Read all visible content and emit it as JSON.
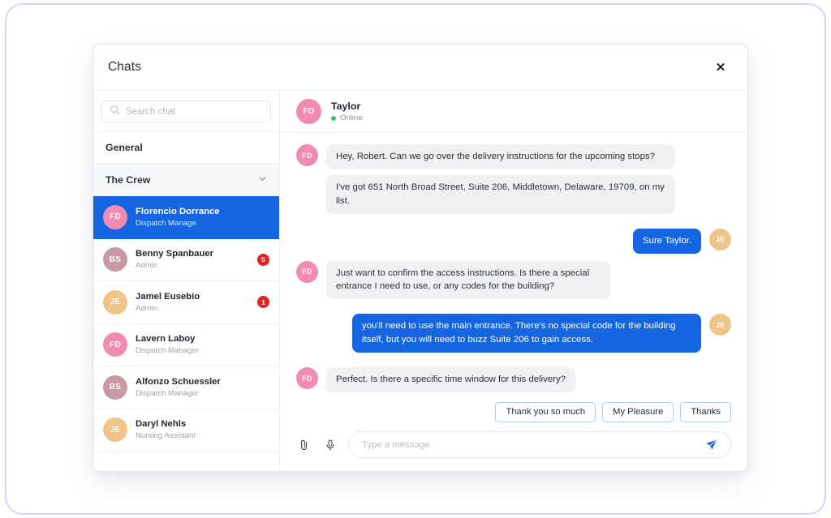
{
  "modal": {
    "title": "Chats",
    "close_icon": "close-icon"
  },
  "sidebar": {
    "search": {
      "placeholder": "Search chat",
      "value": "",
      "icon": "search-icon"
    },
    "groups": [
      {
        "label": "General",
        "expandable": false
      },
      {
        "label": "The Crew",
        "expandable": true,
        "chevron_icon": "chevron-down-icon"
      }
    ],
    "contacts": [
      {
        "initials": "FD",
        "name": "Florencio Dorrance",
        "role": "Dispatch Manage",
        "badge": "",
        "selected": true,
        "avatar_color": "#f08cb4"
      },
      {
        "initials": "BS",
        "name": "Benny Spanbauer",
        "role": "Admin",
        "badge": "5",
        "selected": false,
        "avatar_color": "#c59aa4"
      },
      {
        "initials": "JE",
        "name": "Jamel Eusebio",
        "role": "Admin",
        "badge": "1",
        "selected": false,
        "avatar_color": "#eec488"
      },
      {
        "initials": "FD",
        "name": "Lavern Laboy",
        "role": "Dispatch Manager",
        "badge": "",
        "selected": false,
        "avatar_color": "#f08cb4"
      },
      {
        "initials": "BS",
        "name": "Alfonzo Schuessler",
        "role": "Dispatch Manager",
        "badge": "",
        "selected": false,
        "avatar_color": "#c59aa4"
      },
      {
        "initials": "JE",
        "name": "Daryl Nehls",
        "role": "Nursing Assistant",
        "badge": "",
        "selected": false,
        "avatar_color": "#eec488"
      }
    ]
  },
  "conversation": {
    "peer": {
      "initials": "FD",
      "name": "Taylor",
      "status": "Online",
      "status_color": "#2ecc5d"
    },
    "messages": [
      {
        "direction": "in",
        "initials": "FD",
        "texts": [
          "Hey, Robert. Can we go over the delivery instructions for the upcoming stops?",
          "I've got 651 North Broad Street, Suite 206, Middletown, Delaware, 19709, on my list."
        ]
      },
      {
        "direction": "out",
        "initials": "JE",
        "texts": [
          "Sure Taylor."
        ]
      },
      {
        "direction": "in",
        "initials": "FD",
        "texts": [
          "Just want to confirm the access instructions. Is there a special entrance I need to use, or any codes for the building?"
        ]
      },
      {
        "direction": "out",
        "initials": "JE",
        "texts": [
          "you'll need to use the main entrance. There's no special code for the building itself, but you will need to buzz Suite 206 to gain access."
        ]
      },
      {
        "direction": "in",
        "initials": "FD",
        "texts": [
          "Perfect. Is there a specific time window for this delivery?"
        ]
      }
    ],
    "quick_replies": [
      "Thank you so much",
      "My Pleasure",
      "Thanks"
    ],
    "composer": {
      "placeholder": "Type a message",
      "value": "",
      "attach_icon": "paperclip-icon",
      "mic_icon": "microphone-icon",
      "send_icon": "send-icon"
    }
  },
  "colors": {
    "accent_blue": "#1565e0",
    "badge_red": "#e02424",
    "online_green": "#2ecc5d",
    "incoming_bubble": "#f0f1f3"
  }
}
